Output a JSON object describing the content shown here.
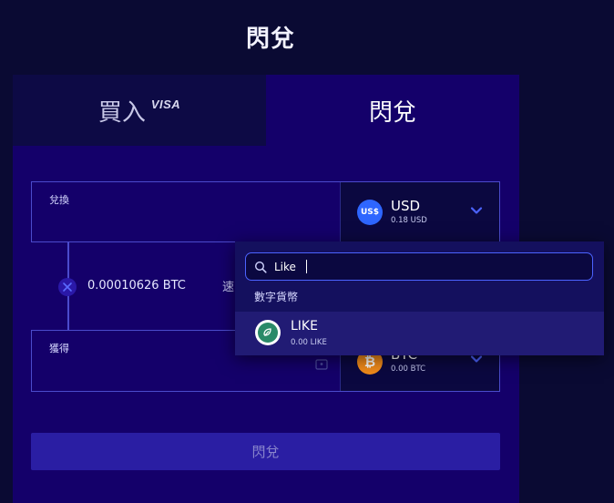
{
  "page": {
    "title": "閃兌"
  },
  "tabs": {
    "buy_label": "買入",
    "buy_badge": "VISA",
    "swap_label": "閃兌"
  },
  "from": {
    "label": "兌換",
    "currency_code": "USD",
    "currency_icon_text": "US$",
    "balance": "0.18 USD"
  },
  "rate": {
    "value": "0.00010626 BTC",
    "trailing_text": "速"
  },
  "to": {
    "label": "獲得",
    "currency_code": "BTC",
    "currency_icon_text": "₿",
    "balance": "0.00 BTC"
  },
  "action": {
    "swap_label": "閃兌"
  },
  "dropdown": {
    "search_value": "Like",
    "section_label": "數字貨幣",
    "results": [
      {
        "code": "LIKE",
        "balance": "0.00 LIKE"
      }
    ]
  },
  "colors": {
    "background": "#0a0a33",
    "card": "#14006a",
    "accent_border": "#4b4bcc",
    "usd_coin": "#2e66ff",
    "btc_coin": "#f08a1a",
    "like_coin": "#2a8a68"
  },
  "icons": {
    "chevron": "chevron-down-icon",
    "search": "search-icon",
    "lock": "lock-icon",
    "multiply": "close-icon"
  }
}
